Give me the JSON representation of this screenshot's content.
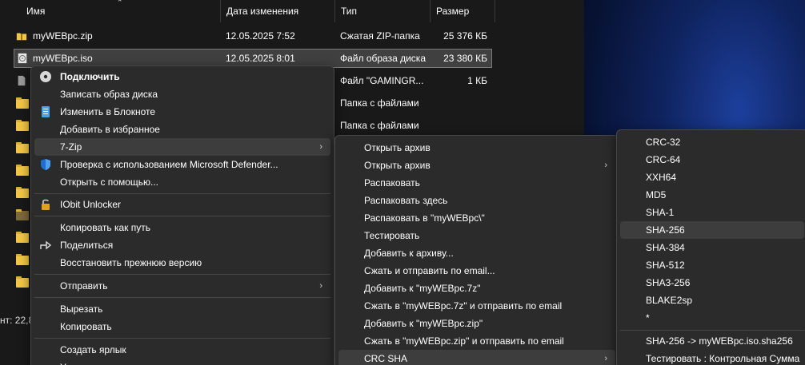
{
  "columns": {
    "name": "Имя",
    "date": "Дата изменения",
    "type": "Тип",
    "size": "Размер"
  },
  "files": [
    {
      "name": "myWEBpc.zip",
      "date": "12.05.2025 7:52",
      "type": "Сжатая ZIP-папка",
      "size": "25 376 КБ",
      "icon": "zip-folder-icon"
    },
    {
      "name": "myWEBpc.iso",
      "date": "12.05.2025 8:01",
      "type": "Файл образа диска",
      "size": "23 380 КБ",
      "icon": "disc-image-icon",
      "selected": true
    },
    {
      "name": "",
      "date": "",
      "type": "Файл \"GAMINGR...",
      "size": "1 КБ",
      "icon": "file-icon"
    },
    {
      "name": "",
      "date": "",
      "type": "Папка с файлами",
      "size": "",
      "icon": "folder-icon"
    },
    {
      "name": "",
      "date": "",
      "type": "Папка с файлами",
      "size": "",
      "icon": "folder-icon"
    }
  ],
  "status": "нт: 22,8",
  "context_menu": {
    "items": [
      {
        "label": "Подключить",
        "bold": true,
        "icon": "disc-icon"
      },
      {
        "label": "Записать образ диска"
      },
      {
        "label": "Изменить в Блокноте",
        "icon": "notepad-icon"
      },
      {
        "label": "Добавить в избранное"
      },
      {
        "label": "7-Zip",
        "submenu": true,
        "highlighted": true
      },
      {
        "label": "Проверка с использованием Microsoft Defender...",
        "icon": "defender-shield-icon"
      },
      {
        "label": "Открыть с помощью..."
      },
      {
        "label": "IObit Unlocker",
        "icon": "unlocker-icon"
      },
      {
        "label": "Копировать как путь"
      },
      {
        "label": "Поделиться",
        "icon": "share-icon"
      },
      {
        "label": "Восстановить прежнюю версию"
      },
      {
        "label": "Отправить",
        "submenu": true
      },
      {
        "label": "Вырезать"
      },
      {
        "label": "Копировать"
      },
      {
        "label": "Создать ярлык"
      },
      {
        "label": "У..."
      }
    ]
  },
  "zip_menu": {
    "items": [
      {
        "label": "Открыть архив"
      },
      {
        "label": "Открыть архив",
        "submenu": true
      },
      {
        "label": "Распаковать"
      },
      {
        "label": "Распаковать здесь"
      },
      {
        "label": "Распаковать в \"myWEBpc\\\""
      },
      {
        "label": "Тестировать"
      },
      {
        "label": "Добавить к архиву..."
      },
      {
        "label": "Сжать и отправить по email..."
      },
      {
        "label": "Добавить к \"myWEBpc.7z\""
      },
      {
        "label": "Сжать в \"myWEBpc.7z\" и отправить по email"
      },
      {
        "label": "Добавить к \"myWEBpc.zip\""
      },
      {
        "label": "Сжать в \"myWEBpc.zip\" и отправить по email"
      },
      {
        "label": "CRC SHA",
        "submenu": true,
        "highlighted": true
      }
    ]
  },
  "hash_menu": {
    "items": [
      {
        "label": "CRC-32"
      },
      {
        "label": "CRC-64"
      },
      {
        "label": "XXH64"
      },
      {
        "label": "MD5"
      },
      {
        "label": "SHA-1"
      },
      {
        "label": "SHA-256",
        "highlighted": true
      },
      {
        "label": "SHA-384"
      },
      {
        "label": "SHA-512"
      },
      {
        "label": "SHA3-256"
      },
      {
        "label": "BLAKE2sp"
      },
      {
        "label": "*"
      },
      {
        "label": "SHA-256 -> myWEBpc.iso.sha256"
      },
      {
        "label": "Тестировать : Контрольная Сумма"
      }
    ]
  },
  "colors": {
    "menu_bg": "#2b2b2b",
    "highlight": "#3d3d3d",
    "folder": "#f2c744",
    "defender": "#1f6fd0"
  }
}
